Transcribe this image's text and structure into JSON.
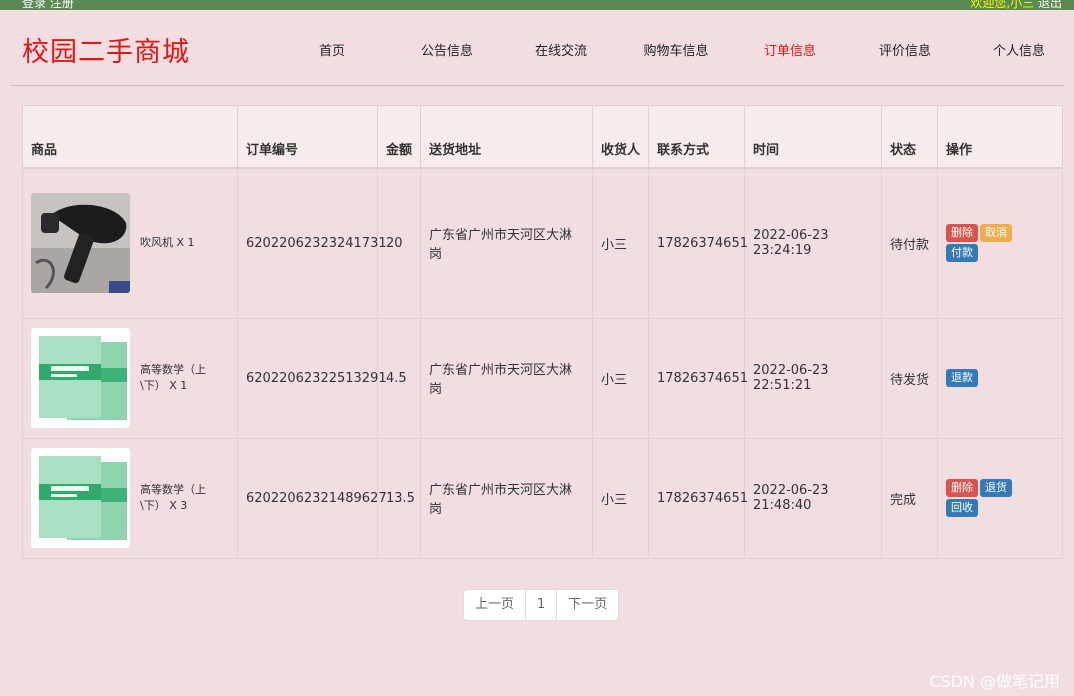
{
  "topbar": {
    "left": "登录 注册",
    "welcome": "欢迎您,小三",
    "logout": "退出"
  },
  "site": {
    "title": "校园二手商城"
  },
  "nav": [
    {
      "label": "首页",
      "active": false
    },
    {
      "label": "公告信息",
      "active": false
    },
    {
      "label": "在线交流",
      "active": false
    },
    {
      "label": "购物车信息",
      "active": false
    },
    {
      "label": "订单信息",
      "active": true
    },
    {
      "label": "评价信息",
      "active": false
    },
    {
      "label": "个人信息",
      "active": false
    }
  ],
  "table": {
    "headers": [
      "商品",
      "订单编号",
      "金额",
      "送货地址",
      "收货人",
      "联系方式",
      "时间",
      "状态",
      "操作"
    ],
    "rows": [
      {
        "product": "吹风机 X 1",
        "image": "hair-dryer-image",
        "order_no": "62022062323241731",
        "amount": "20",
        "address": "广东省广州市天河区大淋岗",
        "receiver": "小三",
        "phone": "17826374651",
        "time": "2022-06-23 23:24:19",
        "status": "待付款",
        "actions": [
          {
            "label": "删除",
            "color": "#d9534f"
          },
          {
            "label": "取消",
            "color": "#f0ad4e"
          },
          {
            "label": "付款",
            "color": "#337ab7"
          }
        ]
      },
      {
        "product": "高等数学（上\\下） X 1",
        "image": "math-textbook-image",
        "order_no": "62022062322513291",
        "amount": "4.5",
        "address": "广东省广州市天河区大淋岗",
        "receiver": "小三",
        "phone": "17826374651",
        "time": "2022-06-23 22:51:21",
        "status": "待发货",
        "actions": [
          {
            "label": "退款",
            "color": "#337ab7"
          }
        ]
      },
      {
        "product": "高等数学（上\\下） X 3",
        "image": "math-textbook-image",
        "order_no": "62022062321489627",
        "amount": "13.5",
        "address": "广东省广州市天河区大淋岗",
        "receiver": "小三",
        "phone": "17826374651",
        "time": "2022-06-23 21:48:40",
        "status": "完成",
        "actions": [
          {
            "label": "删除",
            "color": "#d9534f"
          },
          {
            "label": "退货",
            "color": "#337ab7"
          },
          {
            "label": "回收",
            "color": "#337ab7"
          }
        ]
      }
    ]
  },
  "pagination": {
    "prev": "上一页",
    "page": "1",
    "next": "下一页"
  },
  "watermark": "CSDN @做笔记用"
}
